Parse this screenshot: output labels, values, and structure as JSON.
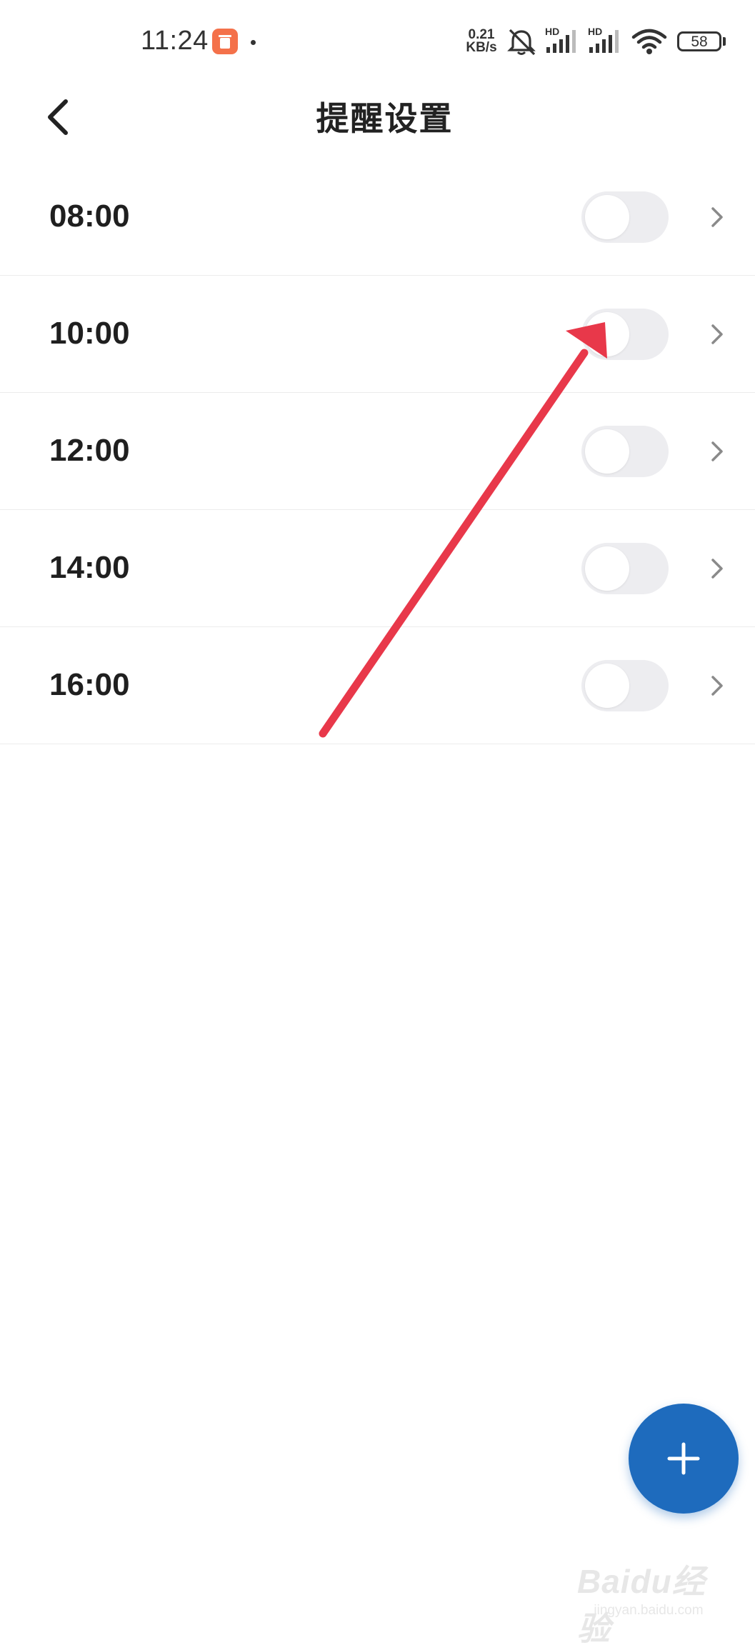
{
  "status_bar": {
    "time": "11:24",
    "network_speed_value": "0.21",
    "network_speed_unit": "KB/s",
    "signal_1_label": "HD",
    "signal_2_label": "HD",
    "battery_level": "58",
    "app_icon": "orange-app-icon",
    "icons": [
      "mute-icon",
      "signal-icon",
      "wifi-icon",
      "battery-icon"
    ]
  },
  "header": {
    "title": "提醒设置",
    "back_icon": "chevron-left-icon"
  },
  "reminders": [
    {
      "time": "08:00",
      "enabled": false
    },
    {
      "time": "10:00",
      "enabled": false
    },
    {
      "time": "12:00",
      "enabled": false
    },
    {
      "time": "14:00",
      "enabled": false
    },
    {
      "time": "16:00",
      "enabled": false
    }
  ],
  "fab": {
    "icon": "plus-icon",
    "color": "#1e6bbd"
  },
  "annotation": {
    "color": "#e8384a"
  },
  "watermark": {
    "logo": "Baidu经验",
    "url": "jingyan.baidu.com"
  },
  "colors": {
    "toggle_off": "#ededf0",
    "divider": "#ececec",
    "text": "#1f1f1f"
  }
}
